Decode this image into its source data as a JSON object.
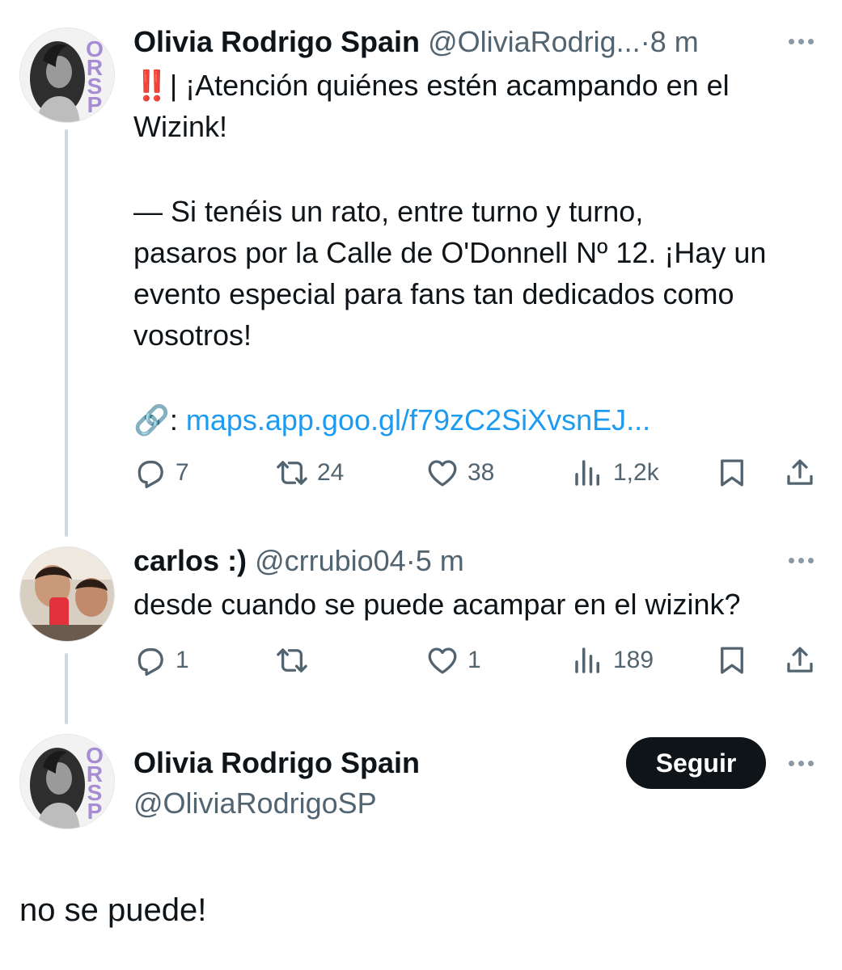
{
  "tweets": [
    {
      "display_name": "Olivia Rodrigo Spain",
      "handle": "@OliviaRodrig...",
      "separator": "·",
      "time": "8 m",
      "emoji": "‼️",
      "text_line1": "| ¡Atención quiénes estén acampando en el",
      "text_line2": "Wizink!",
      "text_para2": [
        "— Si tenéis un rato, entre turno y turno,",
        "pasaros por la Calle de O'Donnell Nº 12. ¡Hay un",
        "evento especial para fans tan dedicados como",
        "vosotros!"
      ],
      "link_prefix": "🔗: ",
      "link_text": "maps.app.goo.gl/f79zC2SiXvsnEJ...",
      "stats": {
        "replies": "7",
        "retweets": "24",
        "likes": "38",
        "views": "1,2k"
      }
    },
    {
      "display_name": "carlos :)",
      "handle": "@crrubio04",
      "separator": "·",
      "time": "5 m",
      "text": "desde cuando se puede acampar en el wizink?",
      "stats": {
        "replies": "1",
        "retweets": "",
        "likes": "1",
        "views": "189"
      }
    }
  ],
  "main_tweet": {
    "display_name": "Olivia Rodrigo Spain",
    "handle": "@OliviaRodrigoSP",
    "follow_label": "Seguir",
    "text": "no se puede!"
  },
  "avatar_badge_letters": [
    "O",
    "R",
    "S",
    "P"
  ],
  "colors": {
    "link": "#1d9bf0",
    "muted": "#536471",
    "badge": "#a78bd3",
    "button": "#0f1419"
  },
  "icons": [
    "reply-icon",
    "retweet-icon",
    "like-icon",
    "views-icon",
    "bookmark-icon",
    "share-icon",
    "more-icon",
    "link-icon"
  ]
}
